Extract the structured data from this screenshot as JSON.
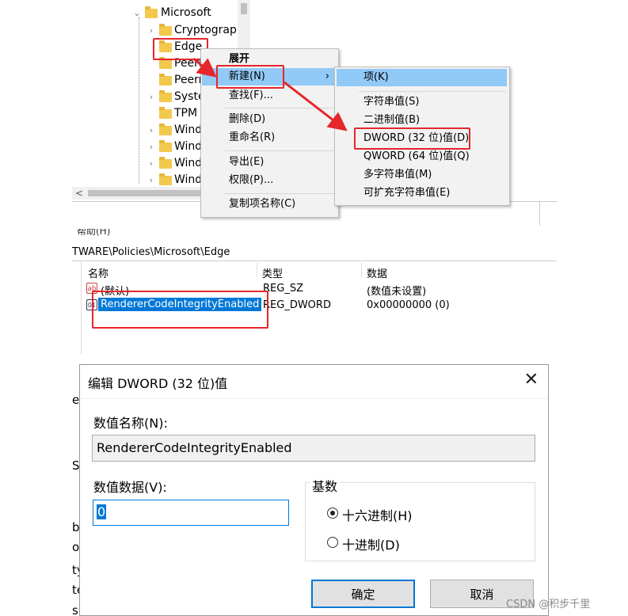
{
  "tree": {
    "root": "Microsoft",
    "items": [
      "Cryptograph",
      "Edge",
      "PeerD",
      "Peern",
      "Syste",
      "TPM",
      "Wind",
      "Wind",
      "Wind",
      "Wind"
    ]
  },
  "context_menu": {
    "expand": "展开",
    "new": "新建(N)",
    "find": "查找(F)...",
    "delete": "删除(D)",
    "rename": "重命名(R)",
    "export": "导出(E)",
    "permissions": "权限(P)...",
    "copy_key_name": "复制项名称(C)"
  },
  "submenu": {
    "key": "项(K)",
    "string": "字符串值(S)",
    "binary": "二进制值(B)",
    "dword": "DWORD (32 位)值(D)",
    "qword": "QWORD (64 位)值(Q)",
    "multi_string": "多字符串值(M)",
    "expandable_string": "可扩充字符串值(E)"
  },
  "values_view": {
    "partial_menu": "帮助(H)",
    "path": "TWARE\\Policies\\Microsoft\\Edge",
    "columns": [
      "名称",
      "类型",
      "数据"
    ],
    "rows": [
      {
        "name": "(默认)",
        "type": "REG_SZ",
        "data": "(数值未设置)"
      },
      {
        "name": "RendererCodeIntegrityEnabled",
        "type": "REG_DWORD",
        "data": "0x00000000 (0)"
      }
    ]
  },
  "dialog": {
    "title": "编辑 DWORD (32 位)值",
    "name_label": "数值名称(N):",
    "name_value": "RendererCodeIntegrityEnabled",
    "data_label": "数值数据(V):",
    "data_value": "0",
    "base_label": "基数",
    "hex_label": "十六进制(H)",
    "dec_label": "十进制(D)",
    "ok": "确定",
    "cancel": "取消",
    "base_selected": "hex"
  },
  "left_fragments": [
    "e",
    "SH",
    "be",
    "o",
    "ty",
    "te",
    "s"
  ],
  "watermark": "CSDN @积步千里",
  "colors": {
    "highlight": "#91c9f7",
    "selection": "#0078d7",
    "annotation_red": "#e5262b",
    "folder": "#f2c94c"
  }
}
